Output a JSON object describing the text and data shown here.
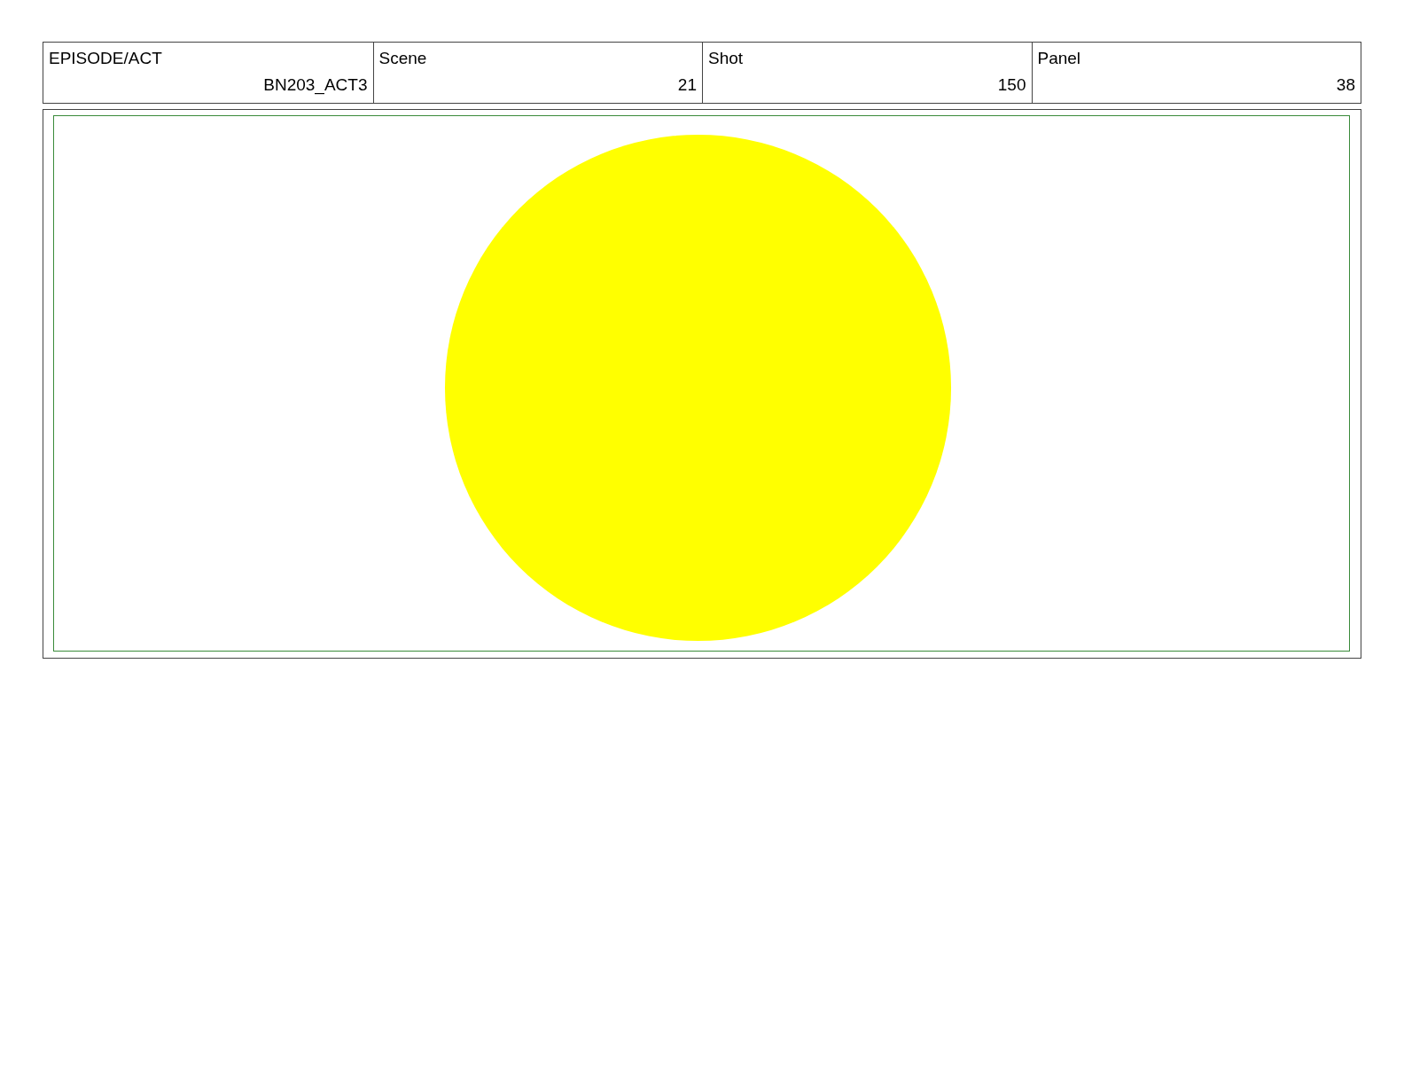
{
  "header_table": {
    "columns": [
      "EPISODE/ACT",
      "Scene",
      "Shot",
      "Panel"
    ],
    "row": [
      "BN203_ACT3",
      "21",
      "150",
      "38"
    ]
  }
}
